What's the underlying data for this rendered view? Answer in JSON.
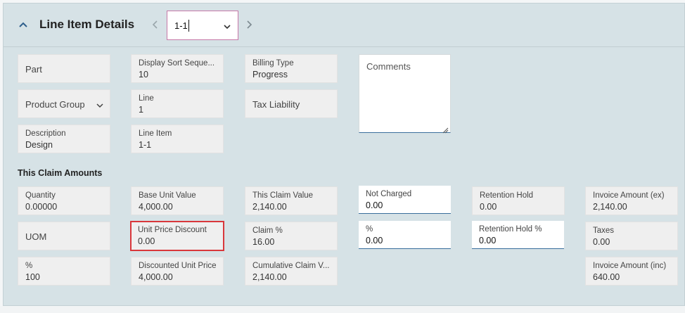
{
  "header": {
    "title": "Line Item Details",
    "record_value": "1-1"
  },
  "general": {
    "part": "Part",
    "product_group": "Product Group",
    "description_label": "Description",
    "description_value": "Design",
    "display_sort_label": "Display Sort Seque...",
    "display_sort_value": "10",
    "line_label": "Line",
    "line_value": "1",
    "line_item_label": "Line Item",
    "line_item_value": "1-1",
    "billing_type_label": "Billing Type",
    "billing_type_value": "Progress",
    "tax_liability": "Tax Liability",
    "comments_placeholder": "Comments"
  },
  "claim": {
    "section_title": "This Claim Amounts",
    "quantity_label": "Quantity",
    "quantity_value": "0.00000",
    "uom": "UOM",
    "pct_label": "%",
    "pct_value": "100",
    "base_unit_value_label": "Base Unit Value",
    "base_unit_value_value": "4,000.00",
    "unit_price_discount_label": "Unit Price Discount",
    "unit_price_discount_value": "0.00",
    "discounted_unit_price_label": "Discounted Unit Price",
    "discounted_unit_price_value": "4,000.00",
    "this_claim_value_label": "This Claim Value",
    "this_claim_value_value": "2,140.00",
    "claim_pct_label": "Claim %",
    "claim_pct_value": "16.00",
    "cumulative_claim_label": "Cumulative Claim V...",
    "cumulative_claim_value": "2,140.00",
    "not_charged_label": "Not Charged",
    "not_charged_value": "0.00",
    "pct2_label": "%",
    "pct2_value": "0.00",
    "retention_hold_label": "Retention Hold",
    "retention_hold_value": "0.00",
    "retention_hold_pct_label": "Retention Hold %",
    "retention_hold_pct_value": "0.00",
    "invoice_amount_ex_label": "Invoice Amount (ex)",
    "invoice_amount_ex_value": "2,140.00",
    "taxes_label": "Taxes",
    "taxes_value": "0.00",
    "invoice_amount_inc_label": "Invoice Amount (inc)",
    "invoice_amount_inc_value": "640.00"
  },
  "icons": {
    "collapse": "chevron-up-icon",
    "prev": "chevron-left-icon",
    "next": "chevron-right-icon",
    "dropdown": "chevron-down-icon"
  },
  "colors": {
    "panel_bg": "#d6e2e6",
    "field_bg": "#efefef",
    "accent_blue": "#3a6f9c",
    "highlight_red": "#d9373b",
    "select_border": "#c678a8"
  }
}
